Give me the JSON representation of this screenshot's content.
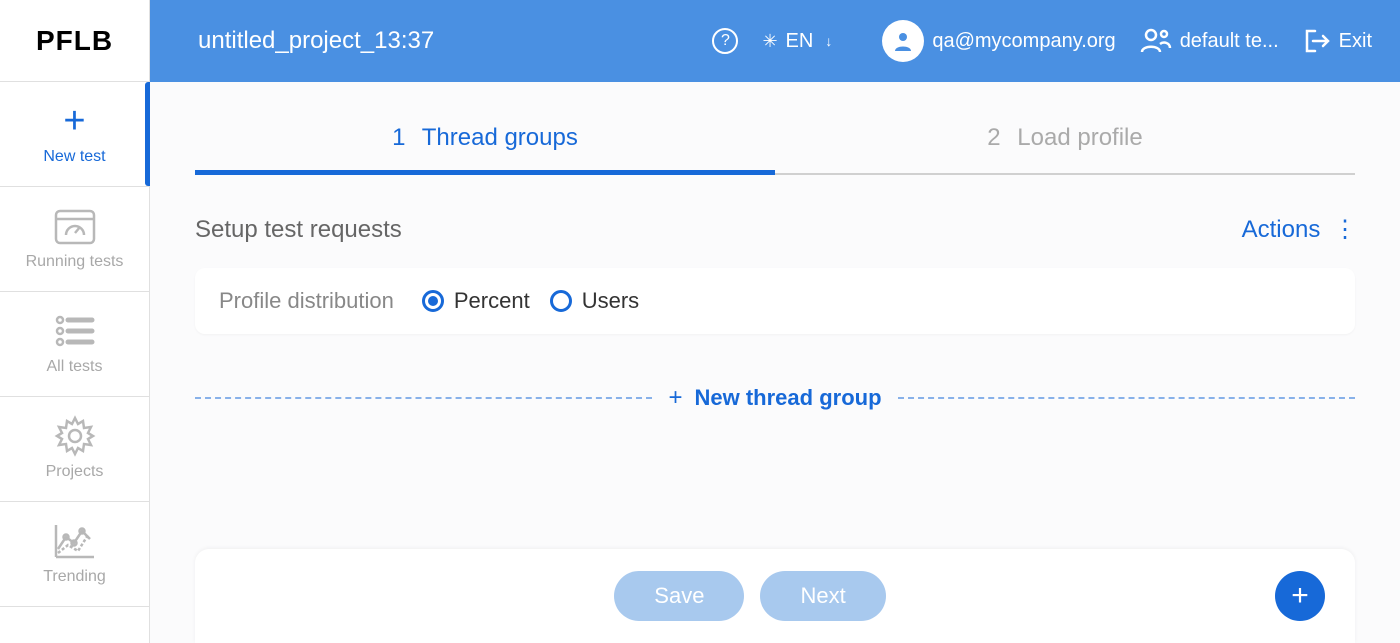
{
  "logo": "PFLB",
  "sidebar": {
    "items": [
      {
        "label": "New test"
      },
      {
        "label": "Running tests"
      },
      {
        "label": "All tests"
      },
      {
        "label": "Projects"
      },
      {
        "label": "Trending"
      }
    ]
  },
  "header": {
    "project_title": "untitled_project_13:37",
    "lang": "EN",
    "user_email": "qa@mycompany.org",
    "team": "default te...",
    "exit": "Exit"
  },
  "tabs": [
    {
      "num": "1",
      "label": "Thread groups"
    },
    {
      "num": "2",
      "label": "Load profile"
    }
  ],
  "section": {
    "title": "Setup test requests",
    "actions": "Actions"
  },
  "profile": {
    "label": "Profile distribution",
    "opt_percent": "Percent",
    "opt_users": "Users"
  },
  "new_thread_group": "New thread group",
  "footer": {
    "save": "Save",
    "next": "Next"
  }
}
